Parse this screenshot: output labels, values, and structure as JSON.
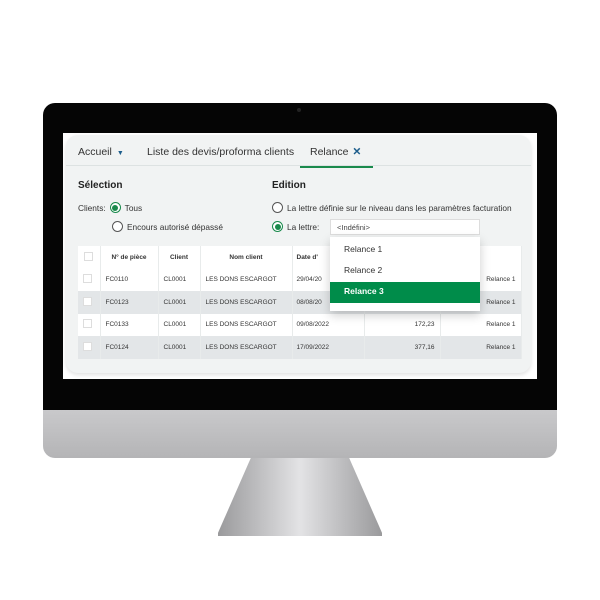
{
  "tabs": {
    "home": "Accueil",
    "list": "Liste des devis/proforma clients",
    "active": "Relance",
    "close": "✕",
    "caret": "▼"
  },
  "selection": {
    "title": "Sélection",
    "clients_label": "Clients:",
    "opt_all": "Tous",
    "opt_exceeded": "Encours autorisé dépassé",
    "selected": "Tous"
  },
  "edition": {
    "title": "Edition",
    "opt_default": "La lettre définie sur le niveau dans les paramètres facturation",
    "opt_letter": "La lettre:",
    "letter_value": "<Indéfini>",
    "selected": "La lettre:"
  },
  "dropdown": {
    "items": [
      "Relance 1",
      "Relance 2",
      "Relance 3"
    ],
    "highlighted": "Relance 3"
  },
  "table": {
    "headers": [
      "",
      "N° de pièce",
      "Client",
      "Nom client",
      "Date d'",
      "",
      ""
    ],
    "rows": [
      [
        "FC0110",
        "CL0001",
        "LES DONS ESCARGOT",
        "29/04/20",
        "",
        "Relance 1"
      ],
      [
        "FC0123",
        "CL0001",
        "LES DONS ESCARGOT",
        "08/08/20",
        "",
        "Relance 1"
      ],
      [
        "FC0133",
        "CL0001",
        "LES DONS ESCARGOT",
        "09/08/2022",
        "172,23",
        "Relance 1"
      ],
      [
        "FC0124",
        "CL0001",
        "LES DONS ESCARGOT",
        "17/09/2022",
        "377,16",
        "Relance 1"
      ]
    ]
  },
  "colors": {
    "accent": "#008c4a",
    "tab_close": "#1d5e8c"
  }
}
